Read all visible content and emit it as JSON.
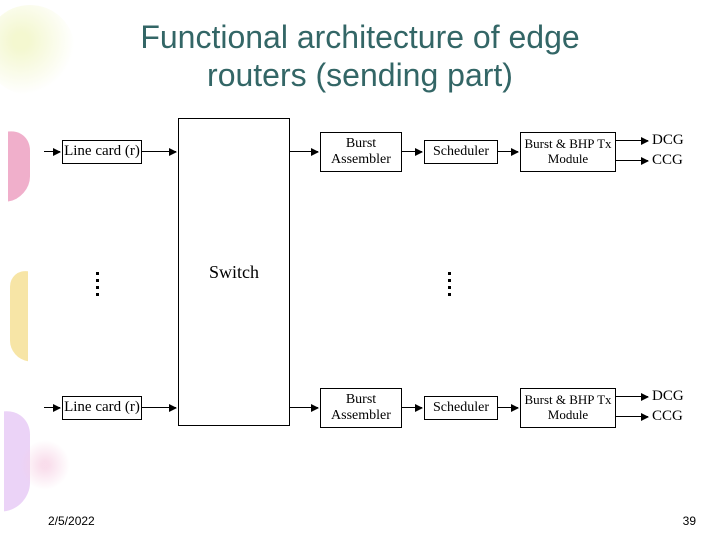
{
  "title_line1": "Functional architecture of edge",
  "title_line2": "routers (sending part)",
  "blocks": {
    "linecard": "Line card (r)",
    "switch": "Switch",
    "burst_assembler": "Burst Assembler",
    "scheduler": "Scheduler",
    "tx_module": "Burst & BHP Tx Module",
    "dcg": "DCG",
    "ccg": "CCG"
  },
  "footer": {
    "date": "2/5/2022",
    "page": "39"
  },
  "chart_data": {
    "type": "diagram",
    "title": "Functional architecture of edge routers (sending part)",
    "nodes": [
      {
        "id": "linecard_top",
        "label": "Line card (r)"
      },
      {
        "id": "linecard_bottom",
        "label": "Line card (r)"
      },
      {
        "id": "switch",
        "label": "Switch"
      },
      {
        "id": "burst_top",
        "label": "Burst Assembler"
      },
      {
        "id": "burst_bottom",
        "label": "Burst Assembler"
      },
      {
        "id": "sched_top",
        "label": "Scheduler"
      },
      {
        "id": "sched_bottom",
        "label": "Scheduler"
      },
      {
        "id": "tx_top",
        "label": "Burst & BHP Tx Module"
      },
      {
        "id": "tx_bottom",
        "label": "Burst & BHP Tx Module"
      },
      {
        "id": "dcg_top",
        "label": "DCG"
      },
      {
        "id": "ccg_top",
        "label": "CCG"
      },
      {
        "id": "dcg_bottom",
        "label": "DCG"
      },
      {
        "id": "ccg_bottom",
        "label": "CCG"
      }
    ],
    "edges": [
      {
        "from": "input_top",
        "to": "linecard_top"
      },
      {
        "from": "linecard_top",
        "to": "switch"
      },
      {
        "from": "input_bottom",
        "to": "linecard_bottom"
      },
      {
        "from": "linecard_bottom",
        "to": "switch"
      },
      {
        "from": "switch",
        "to": "burst_top"
      },
      {
        "from": "burst_top",
        "to": "sched_top"
      },
      {
        "from": "sched_top",
        "to": "tx_top"
      },
      {
        "from": "tx_top",
        "to": "dcg_top"
      },
      {
        "from": "tx_top",
        "to": "ccg_top"
      },
      {
        "from": "switch",
        "to": "burst_bottom"
      },
      {
        "from": "burst_bottom",
        "to": "sched_bottom"
      },
      {
        "from": "sched_bottom",
        "to": "tx_bottom"
      },
      {
        "from": "tx_bottom",
        "to": "dcg_bottom"
      },
      {
        "from": "tx_bottom",
        "to": "ccg_bottom"
      }
    ],
    "notes": "Vertical ellipses between the two rows indicate multiple parallel line cards and pipelines."
  }
}
